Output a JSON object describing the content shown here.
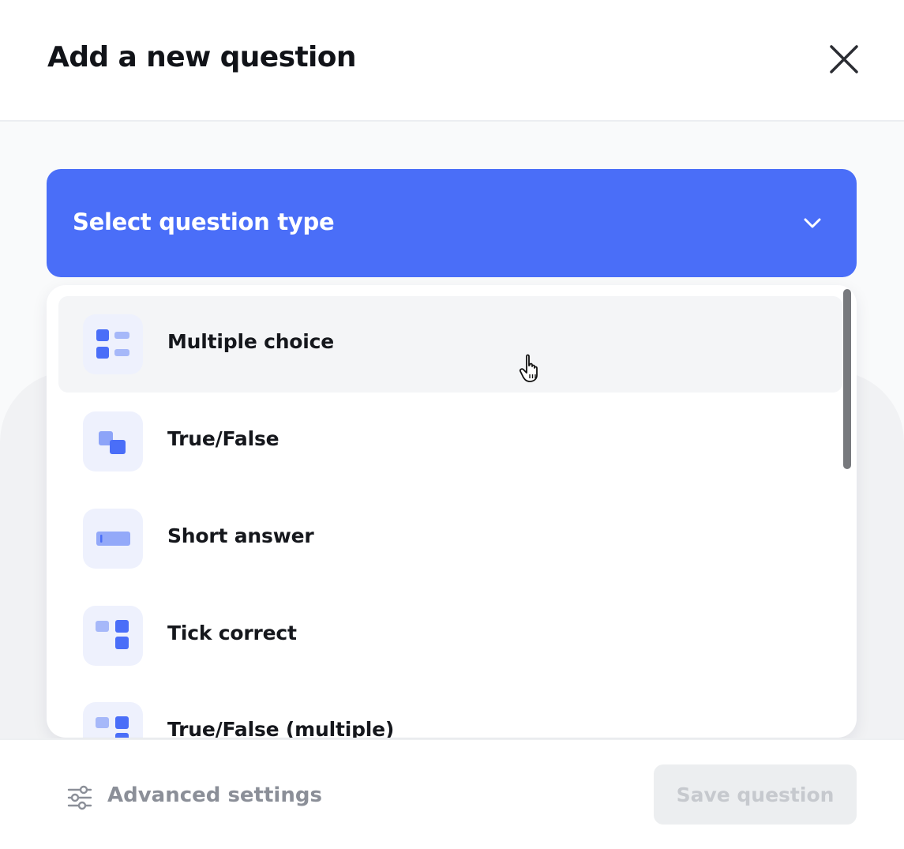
{
  "dialog": {
    "title": "Add a new question",
    "close_icon": "close-icon"
  },
  "select": {
    "label": "Select question type",
    "icon": "chevron-down-icon",
    "accent_color": "#4a6ef8"
  },
  "options": [
    {
      "label": "Multiple choice",
      "icon": "multiple-choice-icon",
      "hovered": true
    },
    {
      "label": "True/False",
      "icon": "true-false-icon"
    },
    {
      "label": "Short answer",
      "icon": "short-answer-icon"
    },
    {
      "label": "Tick correct",
      "icon": "tick-correct-icon"
    },
    {
      "label": "True/False (multiple)",
      "icon": "true-false-multiple-icon"
    }
  ],
  "footer": {
    "advanced_label": "Advanced settings",
    "advanced_icon": "sliders-icon",
    "save_label": "Save question"
  }
}
